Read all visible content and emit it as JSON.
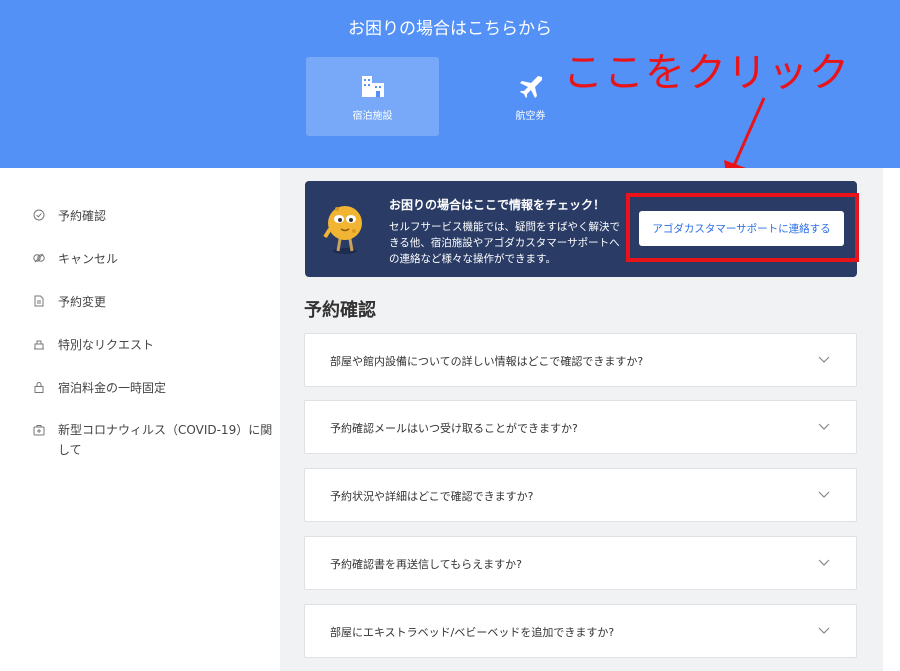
{
  "header": {
    "title": "お困りの場合はこちらから",
    "tabs": [
      {
        "label": "宿泊施設",
        "icon": "building-icon",
        "active": true
      },
      {
        "label": "航空券",
        "icon": "airplane-icon",
        "active": false
      }
    ]
  },
  "annotation": {
    "text": "ここをクリック",
    "color": "#e8141a"
  },
  "sidebar": {
    "items": [
      {
        "label": "予約確認",
        "icon": "check-circle-icon"
      },
      {
        "label": "キャンセル",
        "icon": "cancel-icon"
      },
      {
        "label": "予約変更",
        "icon": "document-icon"
      },
      {
        "label": "特別なリクエスト",
        "icon": "request-icon"
      },
      {
        "label": "宿泊料金の一時固定",
        "icon": "lock-icon"
      },
      {
        "label": "新型コロナウィルス（COVID-19）に関して",
        "icon": "medical-kit-icon"
      }
    ]
  },
  "banner": {
    "title": "お困りの場合はここで情報をチェック！",
    "body": "セルフサービス機能では、疑問をすばやく解決できる他、宿泊施設やアゴダカスタマーサポートへの連絡など様々な操作ができます。",
    "button_label": "アゴダカスタマーサポートに連絡する"
  },
  "main": {
    "section_title": "予約確認",
    "faqs": [
      "部屋や館内設備についての詳しい情報はどこで確認できますか?",
      "予約確認メールはいつ受け取ることができますか?",
      "予約状況や詳細はどこで確認できますか?",
      "予約確認書を再送信してもらえますか?",
      "部屋にエキストラベッド/ベビーベッドを追加できますか?"
    ]
  },
  "colors": {
    "header_bg": "#5391f7",
    "banner_bg": "#2a3c66",
    "button_text": "#2a6ee8",
    "content_bg": "#f1f2f4"
  }
}
